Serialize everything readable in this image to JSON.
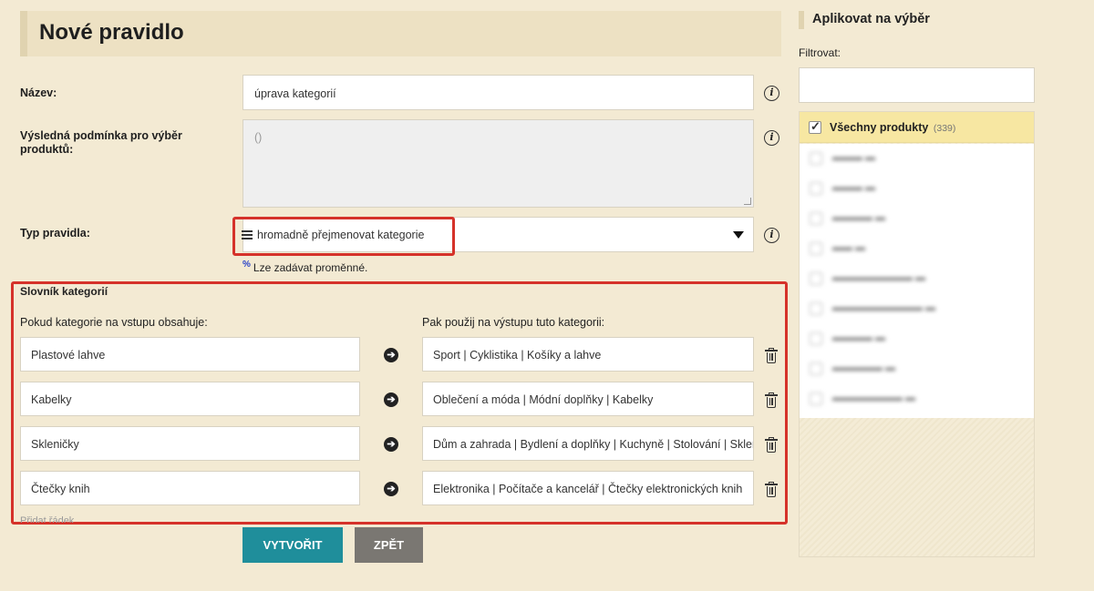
{
  "page": {
    "title": "Nové pravidlo"
  },
  "form": {
    "name_label": "Název:",
    "name_value": "úprava kategorií",
    "condition_label": "Výsledná podmínka pro výběr produktů:",
    "condition_value": "()",
    "rule_type_label": "Typ pravidla:",
    "rule_type_value": "hromadně přejmenovat kategorie",
    "variables_note": "Lze zadávat proměnné.",
    "variables_symbol": "%"
  },
  "dictionary": {
    "title": "Slovník kategorií",
    "input_header": "Pokud kategorie na vstupu obsahuje:",
    "output_header": "Pak použij na výstupu tuto kategorii:",
    "rows": [
      {
        "input": "Plastové lahve",
        "output": "Sport | Cyklistika | Košíky a lahve"
      },
      {
        "input": "Kabelky",
        "output": "Oblečení a móda | Módní doplňky | Kabelky"
      },
      {
        "input": "Skleničky",
        "output": "Dům a zahrada | Bydlení a doplňky | Kuchyně | Stolování | Skleničky"
      },
      {
        "input": "Čtečky knih",
        "output": "Elektronika | Počítače a kancelář | Čtečky elektronických knih"
      }
    ],
    "add_row": "Přidat řádek"
  },
  "actions": {
    "create": "VYTVOŘIT",
    "back": "ZPĚT"
  },
  "sidebar": {
    "title": "Aplikovat na výběr",
    "filter_label": "Filtrovat:",
    "filter_value": "",
    "all_products": {
      "label": "Všechny produkty",
      "count": "(339)",
      "checked": true
    }
  },
  "colors": {
    "accent": "#1f8e9b",
    "highlight": "#d5322a",
    "background": "#f3ead3"
  }
}
